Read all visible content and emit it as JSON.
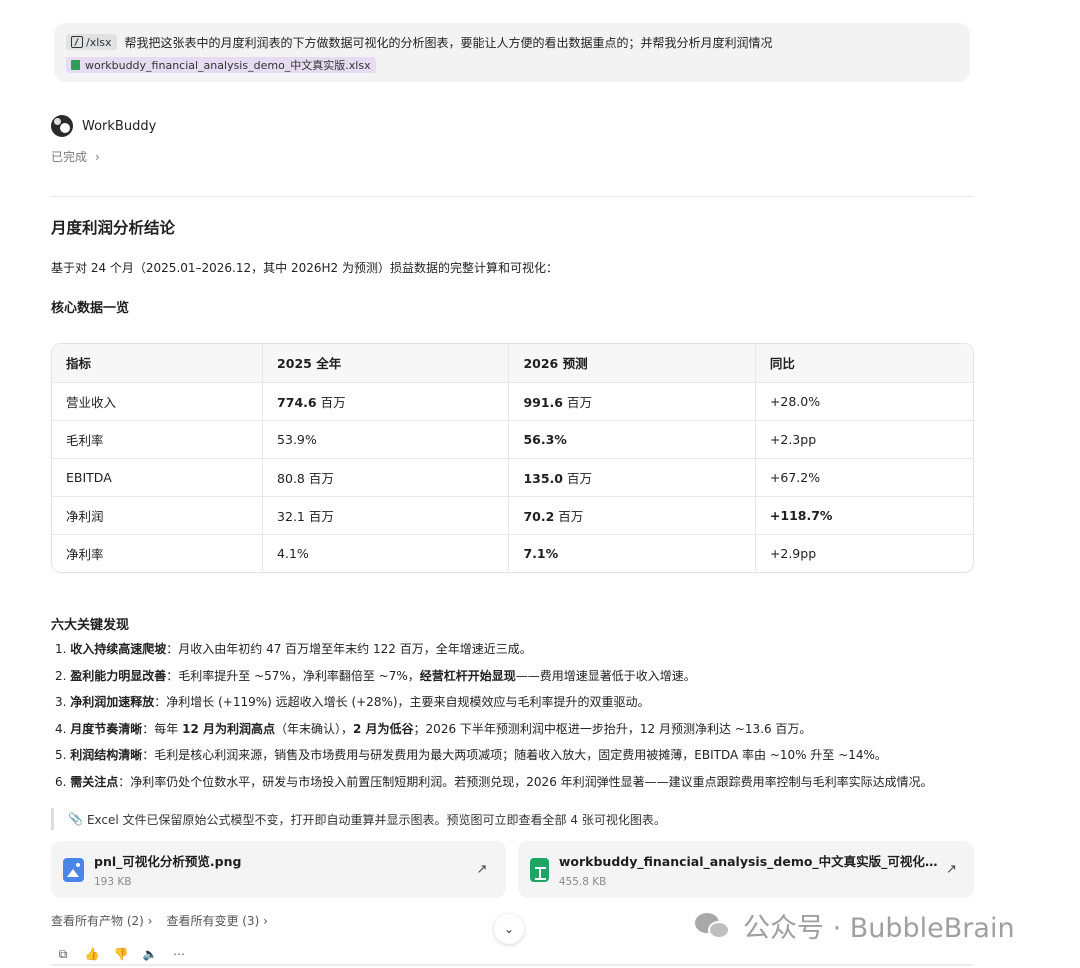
{
  "user_message": {
    "command_chip": "/xlsx",
    "text": "帮我把这张表中的月度利润表的下方做数据可视化的分析图表，要能让人方便的看出数据重点的；并帮我分析月度利润情况",
    "attachment": "workbuddy_financial_analysis_demo_中文真实版.xlsx"
  },
  "agent": {
    "name": "WorkBuddy",
    "status": "已完成"
  },
  "content": {
    "title": "月度利润分析结论",
    "intro": "基于对 24 个月（2025.01–2026.12，其中 2026H2 为预测）损益数据的完整计算和可视化：",
    "core_heading": "核心数据一览",
    "table": {
      "headers": [
        "指标",
        "2025 全年",
        "2026 预测",
        "同比"
      ],
      "rows": [
        {
          "metric": "营业收入",
          "y2025_num": "774.6",
          "y2025_unit": " 百万",
          "y2026_num": "991.6",
          "y2026_unit": " 百万",
          "yoy": "+28.0%"
        },
        {
          "metric": "毛利率",
          "y2025": "53.9%",
          "y2026": "56.3%",
          "yoy": "+2.3pp"
        },
        {
          "metric": "EBITDA",
          "y2025": "80.8 百万",
          "y2026_num": "135.0",
          "y2026_unit": " 百万",
          "yoy": "+67.2%"
        },
        {
          "metric": "净利润",
          "y2025": "32.1 百万",
          "y2026_num": "70.2",
          "y2026_unit": " 百万",
          "yoy": "+118.7%"
        },
        {
          "metric": "净利率",
          "y2025": "4.1%",
          "y2026": "7.1%",
          "yoy": "+2.9pp"
        }
      ]
    },
    "findings_heading": "六大关键发现",
    "findings": [
      {
        "num": "1. ",
        "bold": "收入持续高速爬坡",
        "rest": "：月收入由年初约 47 百万增至年末约 122 百万，全年增速近三成。"
      },
      {
        "num": "2. ",
        "bold": "盈利能力明显改善",
        "rest_a": "：毛利率提升至 ~57%，净利率翻倍至 ~7%，",
        "bold2": "经营杠杆开始显现",
        "rest_b": "——费用增速显著低于收入增速。"
      },
      {
        "num": "3. ",
        "bold": "净利润加速释放",
        "rest": "：净利增长 (+119%) 远超收入增长 (+28%)，主要来自规模效应与毛利率提升的双重驱动。"
      },
      {
        "num": "4. ",
        "bold": "月度节奏清晰",
        "rest_a": "：每年 ",
        "bold2": "12 月为利润高点",
        "rest_b": "（年末确认），",
        "bold3": "2 月为低谷",
        "rest_c": "；2026 下半年预测利润中枢进一步抬升，12 月预测净利达 ~13.6 百万。"
      },
      {
        "num": "5. ",
        "bold": "利润结构清晰",
        "rest": "：毛利是核心利润来源，销售及市场费用与研发费用为最大两项减项；随着收入放大，固定费用被摊薄，EBITDA 率由 ~10% 升至 ~14%。"
      },
      {
        "num": "6. ",
        "bold": "需关注点",
        "rest": "：净利率仍处个位数水平，研发与市场投入前置压制短期利润。若预测兑现，2026 年利润弹性显著——建议重点跟踪费用率控制与毛利率实际达成情况。"
      }
    ],
    "note": "Excel 文件已保留原始公式模型不变，打开即自动重算并显示图表。预览图可立即查看全部 4 张可视化图表。"
  },
  "files": [
    {
      "name": "pnl_可视化分析预览.png",
      "size": "193 KB",
      "icon": "image-file-icon"
    },
    {
      "name": "workbuddy_financial_analysis_demo_中文真实版_可视化分析...",
      "size": "455.8 KB",
      "icon": "spreadsheet-file-icon"
    }
  ],
  "links": {
    "artifacts": "查看所有产物 (2) ›",
    "changes": "查看所有变更 (3) ›"
  },
  "watermark": {
    "text": "公众号 · BubbleBrain"
  }
}
